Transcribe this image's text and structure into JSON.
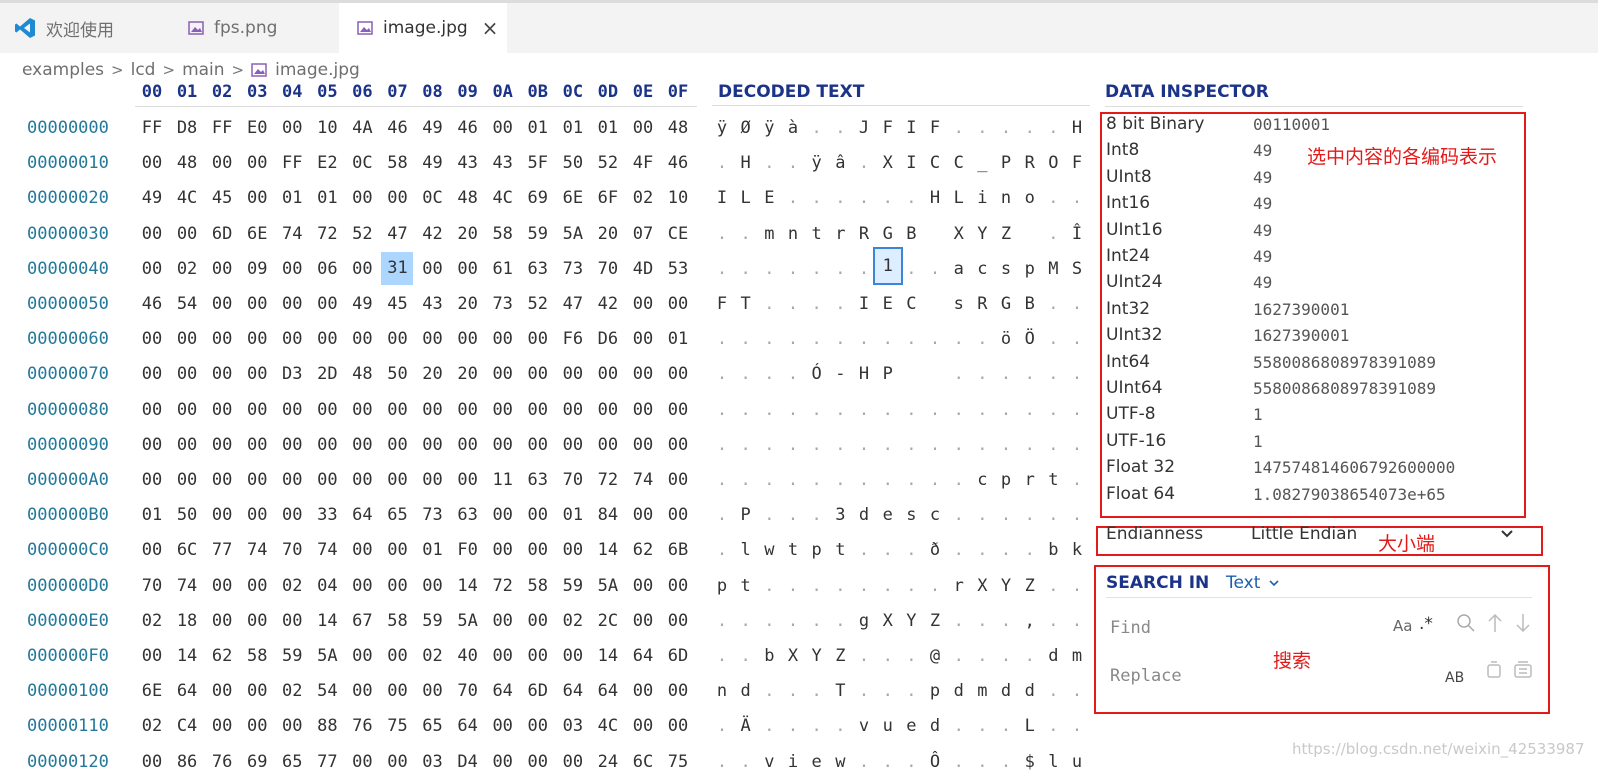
{
  "tabs": [
    {
      "label": "欢迎使用",
      "icon": "vscode-logo-icon",
      "active": false
    },
    {
      "label": "fps.png",
      "icon": "image-file-icon",
      "active": false
    },
    {
      "label": "image.jpg",
      "icon": "image-file-icon",
      "active": true
    }
  ],
  "breadcrumb": [
    "examples",
    "lcd",
    "main",
    "image.jpg"
  ],
  "hex_header": [
    "00",
    "01",
    "02",
    "03",
    "04",
    "05",
    "06",
    "07",
    "08",
    "09",
    "0A",
    "0B",
    "0C",
    "0D",
    "0E",
    "0F"
  ],
  "decoded_header": "DECODED TEXT",
  "rows": [
    {
      "addr": "00000000",
      "bytes": "FF D8 FF E0 00 10 4A 46 49 46 00 01 01 01 00 48",
      "text": [
        "ÿ",
        "Ø",
        "ÿ",
        "à",
        ".",
        ".",
        "J",
        "F",
        "I",
        "F",
        ".",
        ".",
        ".",
        ".",
        ".",
        "H"
      ]
    },
    {
      "addr": "00000010",
      "bytes": "00 48 00 00 FF E2 0C 58 49 43 43 5F 50 52 4F 46",
      "text": [
        ".",
        "H",
        ".",
        ".",
        "ÿ",
        "â",
        ".",
        "X",
        "I",
        "C",
        "C",
        "_",
        "P",
        "R",
        "O",
        "F"
      ]
    },
    {
      "addr": "00000020",
      "bytes": "49 4C 45 00 01 01 00 00 0C 48 4C 69 6E 6F 02 10",
      "text": [
        "I",
        "L",
        "E",
        ".",
        ".",
        ".",
        ".",
        ".",
        ".",
        "H",
        "L",
        "i",
        "n",
        "o",
        ".",
        "."
      ]
    },
    {
      "addr": "00000030",
      "bytes": "00 00 6D 6E 74 72 52 47 42 20 58 59 5A 20 07 CE",
      "text": [
        ".",
        ".",
        "m",
        "n",
        "t",
        "r",
        "R",
        "G",
        "B",
        " ",
        "X",
        "Y",
        "Z",
        " ",
        ".",
        "Î"
      ]
    },
    {
      "addr": "00000040",
      "bytes": "00 02 00 09 00 06 00 31 00 00 61 63 73 70 4D 53",
      "text": [
        ".",
        ".",
        ".",
        ".",
        ".",
        ".",
        ".",
        "1",
        ".",
        ".",
        "a",
        "c",
        "s",
        "p",
        "M",
        "S"
      ]
    },
    {
      "addr": "00000050",
      "bytes": "46 54 00 00 00 00 49 45 43 20 73 52 47 42 00 00",
      "text": [
        "F",
        "T",
        ".",
        ".",
        ".",
        ".",
        "I",
        "E",
        "C",
        " ",
        "s",
        "R",
        "G",
        "B",
        ".",
        "."
      ]
    },
    {
      "addr": "00000060",
      "bytes": "00 00 00 00 00 00 00 00 00 00 00 00 F6 D6 00 01",
      "text": [
        ".",
        ".",
        ".",
        ".",
        ".",
        ".",
        ".",
        ".",
        ".",
        ".",
        ".",
        ".",
        "ö",
        "Ö",
        ".",
        "."
      ]
    },
    {
      "addr": "00000070",
      "bytes": "00 00 00 00 D3 2D 48 50 20 20 00 00 00 00 00 00",
      "text": [
        ".",
        ".",
        ".",
        ".",
        "Ó",
        "-",
        "H",
        "P",
        " ",
        " ",
        ".",
        ".",
        ".",
        ".",
        ".",
        "."
      ]
    },
    {
      "addr": "00000080",
      "bytes": "00 00 00 00 00 00 00 00 00 00 00 00 00 00 00 00",
      "text": [
        ".",
        ".",
        ".",
        ".",
        ".",
        ".",
        ".",
        ".",
        ".",
        ".",
        ".",
        ".",
        ".",
        ".",
        ".",
        "."
      ]
    },
    {
      "addr": "00000090",
      "bytes": "00 00 00 00 00 00 00 00 00 00 00 00 00 00 00 00",
      "text": [
        ".",
        ".",
        ".",
        ".",
        ".",
        ".",
        ".",
        ".",
        ".",
        ".",
        ".",
        ".",
        ".",
        ".",
        ".",
        "."
      ]
    },
    {
      "addr": "000000A0",
      "bytes": "00 00 00 00 00 00 00 00 00 00 11 63 70 72 74 00 00",
      "text": [
        ".",
        ".",
        ".",
        ".",
        ".",
        ".",
        ".",
        ".",
        ".",
        ".",
        ".",
        "c",
        "p",
        "r",
        "t",
        "."
      ]
    },
    {
      "addr": "000000B0",
      "bytes": "01 50 00 00 00 33 64 65 73 63 00 00 01 84 00 00",
      "text": [
        ".",
        "P",
        ".",
        ".",
        ".",
        "3",
        "d",
        "e",
        "s",
        "c",
        ".",
        ".",
        ".",
        ".",
        ".",
        "."
      ]
    },
    {
      "addr": "000000C0",
      "bytes": "00 6C 77 74 70 74 00 00 01 F0 00 00 00 14 62 6B",
      "text": [
        ".",
        "l",
        "w",
        "t",
        "p",
        "t",
        ".",
        ".",
        ".",
        "ð",
        ".",
        ".",
        ".",
        ".",
        "b",
        "k"
      ]
    },
    {
      "addr": "000000D0",
      "bytes": "70 74 00 00 02 04 00 00 00 14 72 58 59 5A 00 00",
      "text": [
        "p",
        "t",
        ".",
        ".",
        ".",
        ".",
        ".",
        ".",
        ".",
        ".",
        "r",
        "X",
        "Y",
        "Z",
        ".",
        "."
      ]
    },
    {
      "addr": "000000E0",
      "bytes": "02 18 00 00 00 14 67 58 59 5A 00 00 02 2C 00 00",
      "text": [
        ".",
        ".",
        ".",
        ".",
        ".",
        ".",
        "g",
        "X",
        "Y",
        "Z",
        ".",
        ".",
        ".",
        ",",
        ".",
        "."
      ]
    },
    {
      "addr": "000000F0",
      "bytes": "00 14 62 58 59 5A 00 00 02 40 00 00 00 14 64 6D",
      "text": [
        ".",
        ".",
        "b",
        "X",
        "Y",
        "Z",
        ".",
        ".",
        ".",
        "@",
        ".",
        ".",
        ".",
        ".",
        "d",
        "m"
      ]
    },
    {
      "addr": "00000100",
      "bytes": "6E 64 00 00 02 54 00 00 00 70 64 6D 64 64 00 00",
      "text": [
        "n",
        "d",
        ".",
        ".",
        ".",
        "T",
        ".",
        ".",
        ".",
        "p",
        "d",
        "m",
        "d",
        "d",
        ".",
        "."
      ]
    },
    {
      "addr": "00000110",
      "bytes": "02 C4 00 00 00 88 76 75 65 64 00 00 03 4C 00 00",
      "text": [
        ".",
        "Ä",
        ".",
        ".",
        ".",
        ".",
        "v",
        "u",
        "e",
        "d",
        ".",
        ".",
        ".",
        "L",
        ".",
        "."
      ]
    },
    {
      "addr": "00000120",
      "bytes": "00 86 76 69 65 77 00 00 03 D4 00 00 00 24 6C 75",
      "text": [
        ".",
        ".",
        "v",
        "i",
        "e",
        "w",
        ".",
        ".",
        ".",
        "Ô",
        ".",
        ".",
        ".",
        "$",
        "l",
        "u"
      ]
    }
  ],
  "selection": {
    "row": 4,
    "col": 7
  },
  "data_inspector": {
    "title": "DATA INSPECTOR",
    "rows": [
      {
        "label": "8 bit Binary",
        "value": "00110001"
      },
      {
        "label": "Int8",
        "value": "49"
      },
      {
        "label": "UInt8",
        "value": "49"
      },
      {
        "label": "Int16",
        "value": "49"
      },
      {
        "label": "UInt16",
        "value": "49"
      },
      {
        "label": "Int24",
        "value": "49"
      },
      {
        "label": "UInt24",
        "value": "49"
      },
      {
        "label": "Int32",
        "value": "1627390001"
      },
      {
        "label": "UInt32",
        "value": "1627390001"
      },
      {
        "label": "Int64",
        "value": "5580086808978391089"
      },
      {
        "label": "UInt64",
        "value": "5580086808978391089"
      },
      {
        "label": "UTF-8",
        "value": "1"
      },
      {
        "label": "UTF-16",
        "value": "1"
      },
      {
        "label": "Float 32",
        "value": "147574814606792600000"
      },
      {
        "label": "Float 64",
        "value": "1.08279038654073e+65"
      }
    ],
    "annotation": "选中内容的各编码表示"
  },
  "endianness": {
    "label": "Endianness",
    "value": "Little Endian",
    "annotation": "大小端"
  },
  "search": {
    "title": "SEARCH IN",
    "mode": "Text",
    "find_placeholder": "Find",
    "replace_placeholder": "Replace",
    "case_label": "Aa",
    "regex_label": ".*",
    "preserve_case_label": "AB",
    "annotation": "搜索"
  },
  "watermark": "https://blog.csdn.net/weixin_42533987",
  "colors": {
    "accent_header": "#1b3388",
    "address": "#24799a",
    "annotation_red": "#e31a1a",
    "selection": "#add6ff"
  }
}
